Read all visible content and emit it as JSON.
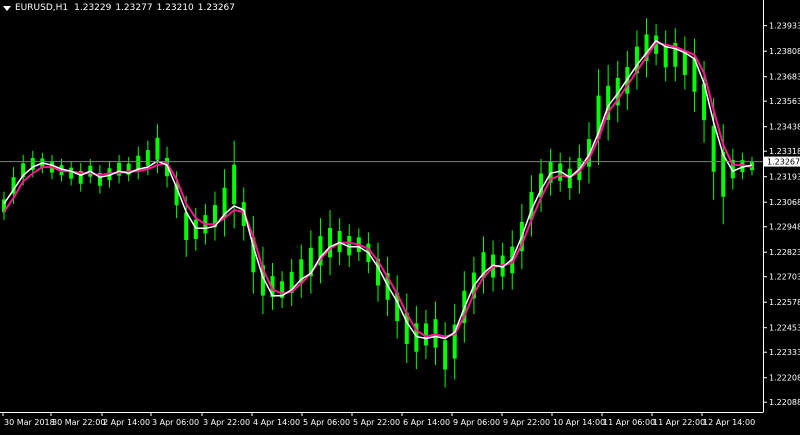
{
  "header": {
    "symbol": "EURUSD,H1",
    "open": "1.23229",
    "high": "1.23277",
    "low": "1.23210",
    "close": "1.23267"
  },
  "colors": {
    "background": "#000000",
    "candle_up": "#00ff00",
    "candle_down": "#00ff00",
    "ma_fast": "#ffffff",
    "ma_slow": "#ff1493",
    "axis": "#ffffff",
    "price_line": "#808080"
  },
  "chart_data": {
    "type": "line",
    "ylim": [
      1.2204,
      1.24
    ],
    "y_ticks": [
      "1.23933",
      "1.23808",
      "1.23683",
      "1.23563",
      "1.23438",
      "1.23318",
      "1.23193",
      "1.23068",
      "1.22948",
      "1.22823",
      "1.22703",
      "1.22578",
      "1.22453",
      "1.22333",
      "1.22208",
      "1.22088"
    ],
    "current_price": "1.23267",
    "x_ticks": [
      "30 Mar 2018",
      "30 Mar 22:00",
      "2 Apr 14:00",
      "3 Apr 06:00",
      "3 Apr 22:00",
      "4 Apr 14:00",
      "5 Apr 06:00",
      "5 Apr 22:00",
      "6 Apr 14:00",
      "9 Apr 06:00",
      "9 Apr 22:00",
      "10 Apr 14:00",
      "11 Apr 06:00",
      "11 Apr 22:00",
      "12 Apr 14:00"
    ],
    "series": [
      {
        "values": [
          1.2306,
          1.2313,
          1.232,
          1.2324,
          1.2326,
          1.2325,
          1.2323,
          1.2322,
          1.232,
          1.2322,
          1.2319,
          1.232,
          1.2322,
          1.2321,
          1.2323,
          1.2324,
          1.2327,
          1.2325,
          1.2314,
          1.2302,
          1.2294,
          1.2294,
          1.2295,
          1.2301,
          1.2305,
          1.2303,
          1.2285,
          1.227,
          1.2261,
          1.2261,
          1.2264,
          1.2269,
          1.2272,
          1.228,
          1.2285,
          1.2287,
          1.2285,
          1.2285,
          1.2282,
          1.2275,
          1.2266,
          1.2258,
          1.2248,
          1.2241,
          1.224,
          1.2241,
          1.224,
          1.2243,
          1.2255,
          1.2266,
          1.2272,
          1.2276,
          1.2275,
          1.2279,
          1.229,
          1.2303,
          1.2313,
          1.2321,
          1.2322,
          1.2319,
          1.2323,
          1.233,
          1.2341,
          1.2354,
          1.236,
          1.2367,
          1.2374,
          1.238,
          1.2386,
          1.2383,
          1.2382,
          1.238,
          1.2377,
          1.2365,
          1.2346,
          1.233,
          1.2322,
          1.2324,
          1.2325
        ]
      },
      {
        "values": [
          1.2302,
          1.2309,
          1.2317,
          1.2321,
          1.2324,
          1.2324,
          1.2322,
          1.2322,
          1.2321,
          1.2321,
          1.232,
          1.2321,
          1.2321,
          1.2322,
          1.2322,
          1.2323,
          1.2325,
          1.2326,
          1.2318,
          1.2306,
          1.2299,
          1.2296,
          1.2296,
          1.2299,
          1.2303,
          1.2302,
          1.229,
          1.2274,
          1.2264,
          1.2262,
          1.2263,
          1.2267,
          1.2272,
          1.2279,
          1.2284,
          1.2287,
          1.2287,
          1.2286,
          1.2284,
          1.2278,
          1.227,
          1.2262,
          1.2252,
          1.2244,
          1.2241,
          1.2242,
          1.2241,
          1.2242,
          1.2251,
          1.2262,
          1.227,
          1.2275,
          1.2276,
          1.2277,
          1.2286,
          1.2298,
          1.2309,
          1.2318,
          1.232,
          1.2319,
          1.2322,
          1.2328,
          1.2338,
          1.2351,
          1.2357,
          1.2364,
          1.2371,
          1.2378,
          1.2385,
          1.2384,
          1.2383,
          1.2381,
          1.2379,
          1.237,
          1.2352,
          1.2335,
          1.2325,
          1.2325,
          1.2324
        ]
      }
    ],
    "candles": [
      [
        1.2298,
        1.2312
      ],
      [
        1.2306,
        1.2324
      ],
      [
        1.2315,
        1.233
      ],
      [
        1.2319,
        1.2332
      ],
      [
        1.2321,
        1.2331
      ],
      [
        1.2318,
        1.233
      ],
      [
        1.2317,
        1.2328
      ],
      [
        1.2315,
        1.2327
      ],
      [
        1.2312,
        1.2326
      ],
      [
        1.2316,
        1.2328
      ],
      [
        1.2311,
        1.2325
      ],
      [
        1.2314,
        1.2327
      ],
      [
        1.2316,
        1.233
      ],
      [
        1.2317,
        1.2329
      ],
      [
        1.2318,
        1.2334
      ],
      [
        1.232,
        1.2337
      ],
      [
        1.2321,
        1.2345
      ],
      [
        1.2314,
        1.2334
      ],
      [
        1.2299,
        1.2322
      ],
      [
        1.228,
        1.231
      ],
      [
        1.2283,
        1.2304
      ],
      [
        1.2286,
        1.2306
      ],
      [
        1.2288,
        1.2312
      ],
      [
        1.229,
        1.2323
      ],
      [
        1.2294,
        1.2337
      ],
      [
        1.2288,
        1.2314
      ],
      [
        1.2262,
        1.23
      ],
      [
        1.2252,
        1.2285
      ],
      [
        1.2254,
        1.2277
      ],
      [
        1.2255,
        1.2273
      ],
      [
        1.2256,
        1.2279
      ],
      [
        1.226,
        1.2286
      ],
      [
        1.2262,
        1.2293
      ],
      [
        1.2267,
        1.2299
      ],
      [
        1.2271,
        1.2303
      ],
      [
        1.2276,
        1.2299
      ],
      [
        1.2275,
        1.2296
      ],
      [
        1.2278,
        1.2294
      ],
      [
        1.2272,
        1.2292
      ],
      [
        1.2258,
        1.2287
      ],
      [
        1.2251,
        1.228
      ],
      [
        1.224,
        1.2271
      ],
      [
        1.2228,
        1.2262
      ],
      [
        1.2225,
        1.2256
      ],
      [
        1.223,
        1.2254
      ],
      [
        1.2227,
        1.2258
      ],
      [
        1.2216,
        1.2248
      ],
      [
        1.222,
        1.2257
      ],
      [
        1.2238,
        1.2273
      ],
      [
        1.2252,
        1.228
      ],
      [
        1.2262,
        1.229
      ],
      [
        1.2263,
        1.2288
      ],
      [
        1.2264,
        1.2287
      ],
      [
        1.2264,
        1.2293
      ],
      [
        1.2274,
        1.2306
      ],
      [
        1.229,
        1.232
      ],
      [
        1.2302,
        1.2328
      ],
      [
        1.231,
        1.2333
      ],
      [
        1.2312,
        1.2331
      ],
      [
        1.2308,
        1.2329
      ],
      [
        1.2311,
        1.2335
      ],
      [
        1.2316,
        1.2346
      ],
      [
        1.2325,
        1.2372
      ],
      [
        1.2337,
        1.2374
      ],
      [
        1.2346,
        1.2376
      ],
      [
        1.2352,
        1.2381
      ],
      [
        1.2362,
        1.2391
      ],
      [
        1.2368,
        1.2397
      ],
      [
        1.2374,
        1.2394
      ],
      [
        1.2366,
        1.2391
      ],
      [
        1.2366,
        1.2392
      ],
      [
        1.2362,
        1.2388
      ],
      [
        1.2351,
        1.2387
      ],
      [
        1.2336,
        1.2376
      ],
      [
        1.2308,
        1.2358
      ],
      [
        1.2296,
        1.2345
      ],
      [
        1.2313,
        1.2333
      ],
      [
        1.2318,
        1.2331
      ],
      [
        1.232,
        1.2329
      ]
    ]
  }
}
